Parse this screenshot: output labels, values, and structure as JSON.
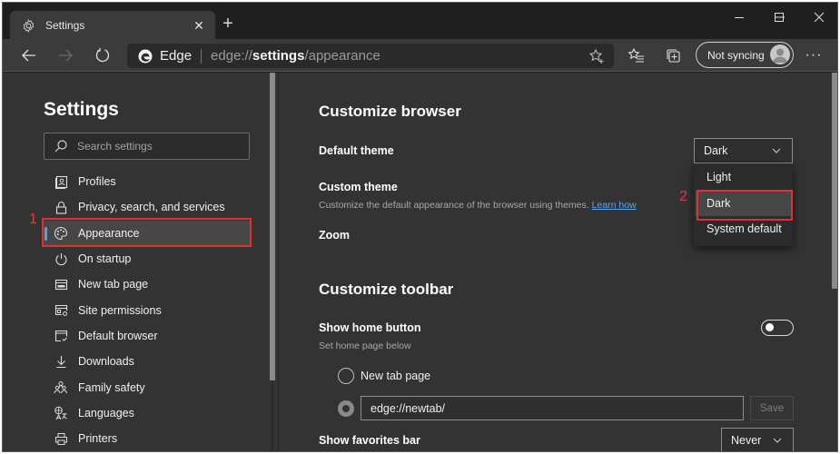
{
  "window": {
    "tab": {
      "title": "Settings",
      "icon": "gear-icon",
      "close_glyph": "✕"
    },
    "new_tab_glyph": "+",
    "controls": {
      "minimize": "minimize-icon",
      "maximize": "maximize-icon",
      "close": "close-icon"
    }
  },
  "toolbar": {
    "browser_name": "Edge",
    "url_prefix": "edge://",
    "url_bold": "settings",
    "url_suffix": "/appearance",
    "sync_label": "Not syncing",
    "more_glyph": "···"
  },
  "sidebar": {
    "title": "Settings",
    "search_placeholder": "Search settings",
    "items": [
      {
        "label": "Profiles",
        "icon": "profile-icon",
        "active": false
      },
      {
        "label": "Privacy, search, and services",
        "icon": "lock-icon",
        "active": false
      },
      {
        "label": "Appearance",
        "icon": "palette-icon",
        "active": true
      },
      {
        "label": "On startup",
        "icon": "power-icon",
        "active": false
      },
      {
        "label": "New tab page",
        "icon": "new-tab-page-icon",
        "active": false
      },
      {
        "label": "Site permissions",
        "icon": "site-permissions-icon",
        "active": false
      },
      {
        "label": "Default browser",
        "icon": "default-browser-icon",
        "active": false
      },
      {
        "label": "Downloads",
        "icon": "download-icon",
        "active": false
      },
      {
        "label": "Family safety",
        "icon": "family-icon",
        "active": false
      },
      {
        "label": "Languages",
        "icon": "languages-icon",
        "active": false
      },
      {
        "label": "Printers",
        "icon": "printer-icon",
        "active": false
      }
    ]
  },
  "annotations": {
    "step1": "1",
    "step2": "2",
    "highlight_color": "#e03131"
  },
  "main": {
    "customize_browser": {
      "title": "Customize browser",
      "default_theme": {
        "label": "Default theme",
        "value": "Dark",
        "options": [
          "Light",
          "Dark",
          "System default"
        ],
        "highlighted": "Dark"
      },
      "custom_theme": {
        "label": "Custom theme",
        "description": "Customize the default appearance of the browser using themes.",
        "link": "Learn how"
      },
      "zoom": {
        "label": "Zoom"
      }
    },
    "customize_toolbar": {
      "title": "Customize toolbar",
      "show_home_button": {
        "label": "Show home button",
        "sub": "Set home page below",
        "enabled": false
      },
      "home_options": [
        {
          "label": "New tab page",
          "selected": false
        }
      ],
      "custom_url": {
        "value": "edge://newtab/",
        "selected": true
      },
      "save_label": "Save",
      "show_favorites_bar": {
        "label": "Show favorites bar",
        "value": "Never"
      }
    }
  },
  "colors": {
    "accent": "#4ca7e8",
    "link": "#5aa8ea",
    "background": "#333333"
  }
}
